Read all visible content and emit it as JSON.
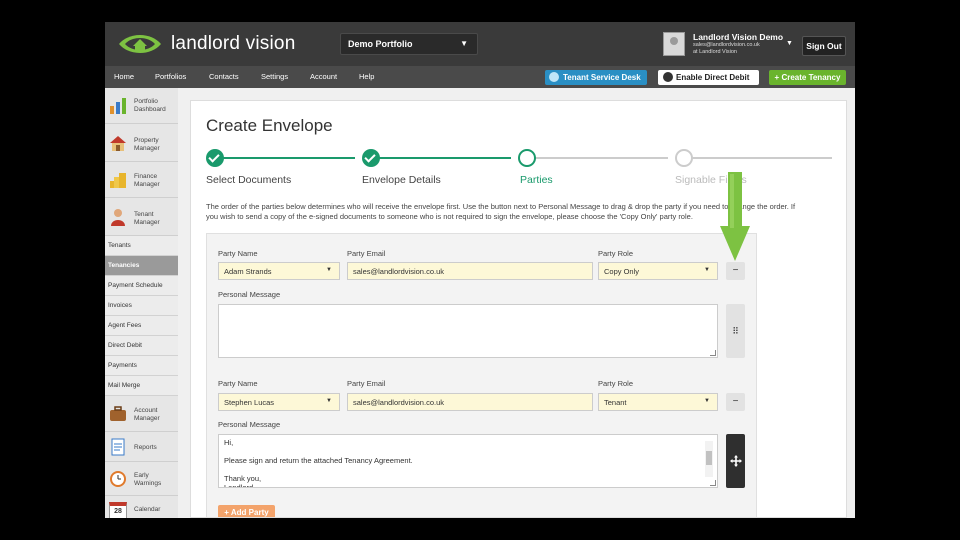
{
  "header": {
    "logo_text": "landlord vision",
    "portfolio": "Demo Portfolio",
    "user": {
      "name": "Landlord Vision Demo",
      "email": "sales@landlordvision.co.uk",
      "org": "at Landlord Vision"
    },
    "signout": "Sign Out"
  },
  "nav": {
    "items": [
      "Home",
      "Portfolios",
      "Contacts",
      "Settings",
      "Account",
      "Help"
    ],
    "tenant_service_desk": "Tenant Service Desk",
    "enable_direct_debit": "Enable Direct Debit",
    "create_tenancy": "+ Create Tenancy"
  },
  "sidebar": {
    "top": [
      {
        "label": "Portfolio Dashboard",
        "icon": "dashboard-icon"
      },
      {
        "label": "Property Manager",
        "icon": "house-icon"
      },
      {
        "label": "Finance Manager",
        "icon": "coins-icon"
      },
      {
        "label": "Tenant Manager",
        "icon": "person-icon"
      }
    ],
    "tenant_sub": [
      "Tenants",
      "Tenancies",
      "Payment Schedule",
      "Invoices",
      "Agent Fees",
      "Direct Debit",
      "Payments",
      "Mail Merge"
    ],
    "active": "Tenancies",
    "bottom": [
      {
        "label": "Account Manager",
        "icon": "briefcase-icon"
      },
      {
        "label": "Reports",
        "icon": "report-icon"
      },
      {
        "label": "Early Warnings",
        "icon": "clock-icon"
      },
      {
        "label": "Calendar",
        "icon": "calendar-icon"
      }
    ],
    "calendar_day": "28"
  },
  "page": {
    "title": "Create Envelope",
    "steps": [
      {
        "label": "Select Documents",
        "status": "done"
      },
      {
        "label": "Envelope Details",
        "status": "done"
      },
      {
        "label": "Parties",
        "status": "current"
      },
      {
        "label": "Signable Fields",
        "status": "todo"
      }
    ],
    "intro": "The order of the parties below determines who will receive the envelope first. Use the button next to Personal Message to drag & drop the party if you need to change the order. If you wish to send a copy of the e-signed documents to someone who is not required to sign the envelope, please choose the 'Copy Only' party role."
  },
  "labels": {
    "party_name": "Party Name",
    "party_email": "Party Email",
    "party_role": "Party Role",
    "personal_message": "Personal Message"
  },
  "parties": [
    {
      "name": "Adam Strands",
      "email": "sales@landlordvision.co.uk",
      "role": "Copy Only",
      "message": ""
    },
    {
      "name": "Stephen Lucas",
      "email": "sales@landlordvision.co.uk",
      "role": "Tenant",
      "message": "Hi,\n\nPlease sign and return the attached Tenancy Agreement.\n\nThank you,\nLandlord"
    }
  ],
  "add_party": "+ Add Party",
  "colors": {
    "accent_green": "#1a9a6c",
    "arrow_green": "#7dc242",
    "field_yellow": "#fdf8d7"
  }
}
